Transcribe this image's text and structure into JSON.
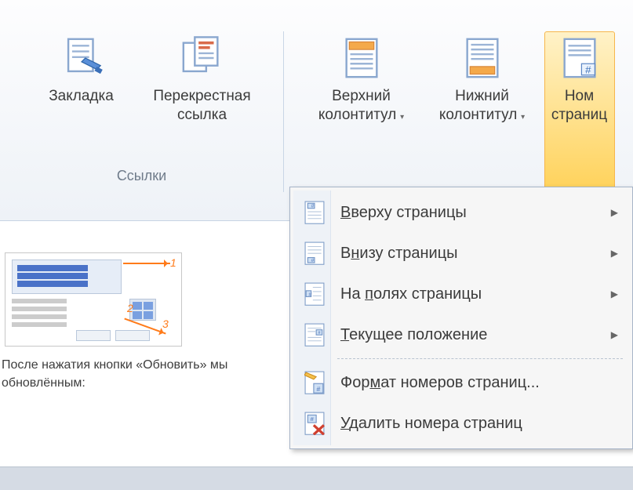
{
  "ribbon": {
    "groups": {
      "links": {
        "caption": "Ссылки",
        "bookmark": {
          "line1": "Закладка"
        },
        "crossref": {
          "line1": "Перекрестная",
          "line2": "ссылка"
        }
      },
      "headerfooter": {
        "header": {
          "line1": "Верхний",
          "line2": "колонтитул"
        },
        "footer": {
          "line1": "Нижний",
          "line2": "колонтитул"
        },
        "pagenum": {
          "line1": "Ном",
          "line2": "страниц"
        }
      }
    }
  },
  "menu": {
    "top_of_page": {
      "pre": "",
      "u": "В",
      "post": "верху страницы"
    },
    "bottom_of_page": {
      "pre": "В",
      "u": "н",
      "post": "изу страницы"
    },
    "page_margins": {
      "pre": "На ",
      "u": "п",
      "post": "олях страницы"
    },
    "current_pos": {
      "pre": "",
      "u": "Т",
      "post": "екущее положение"
    },
    "format_numbers": {
      "pre": "Фор",
      "u": "м",
      "post": "ат номеров страниц..."
    },
    "remove_numbers": {
      "pre": "",
      "u": "У",
      "post": "далить номера страниц"
    }
  },
  "doc": {
    "text_line1": "После нажатия кнопки «Обновить» мы",
    "text_line2": "обновлённым:"
  }
}
